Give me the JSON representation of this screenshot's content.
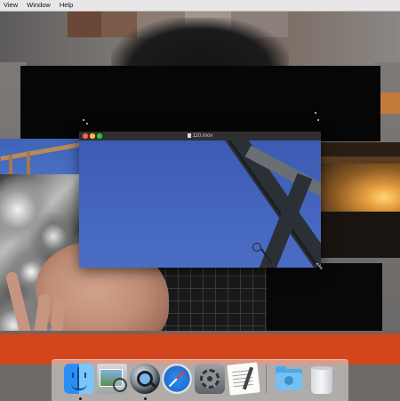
{
  "menubar": {
    "items": [
      "View",
      "Window",
      "Help"
    ]
  },
  "player": {
    "title": "110.mov",
    "file_icon": "movie-file-icon",
    "resize_glyph": "⤡"
  },
  "dock": {
    "apps": [
      {
        "name": "Finder",
        "icon": "finder-icon",
        "running": true
      },
      {
        "name": "Preview",
        "icon": "preview-icon",
        "running": false
      },
      {
        "name": "QuickTime Player",
        "icon": "quicktime-icon",
        "running": true
      },
      {
        "name": "Safari",
        "icon": "safari-icon",
        "running": false
      },
      {
        "name": "System Preferences",
        "icon": "system-preferences-icon",
        "running": false
      },
      {
        "name": "TextEdit",
        "icon": "textedit-icon",
        "running": false
      },
      {
        "name": "Downloads",
        "icon": "downloads-folder-icon",
        "running": false
      },
      {
        "name": "Trash",
        "icon": "trash-icon",
        "running": false
      }
    ]
  },
  "colors": {
    "close": "#fe5f57",
    "minimize": "#febc2e",
    "zoom": "#28c840",
    "sky": "#3f5fb6",
    "shirt": "#d3461d"
  }
}
